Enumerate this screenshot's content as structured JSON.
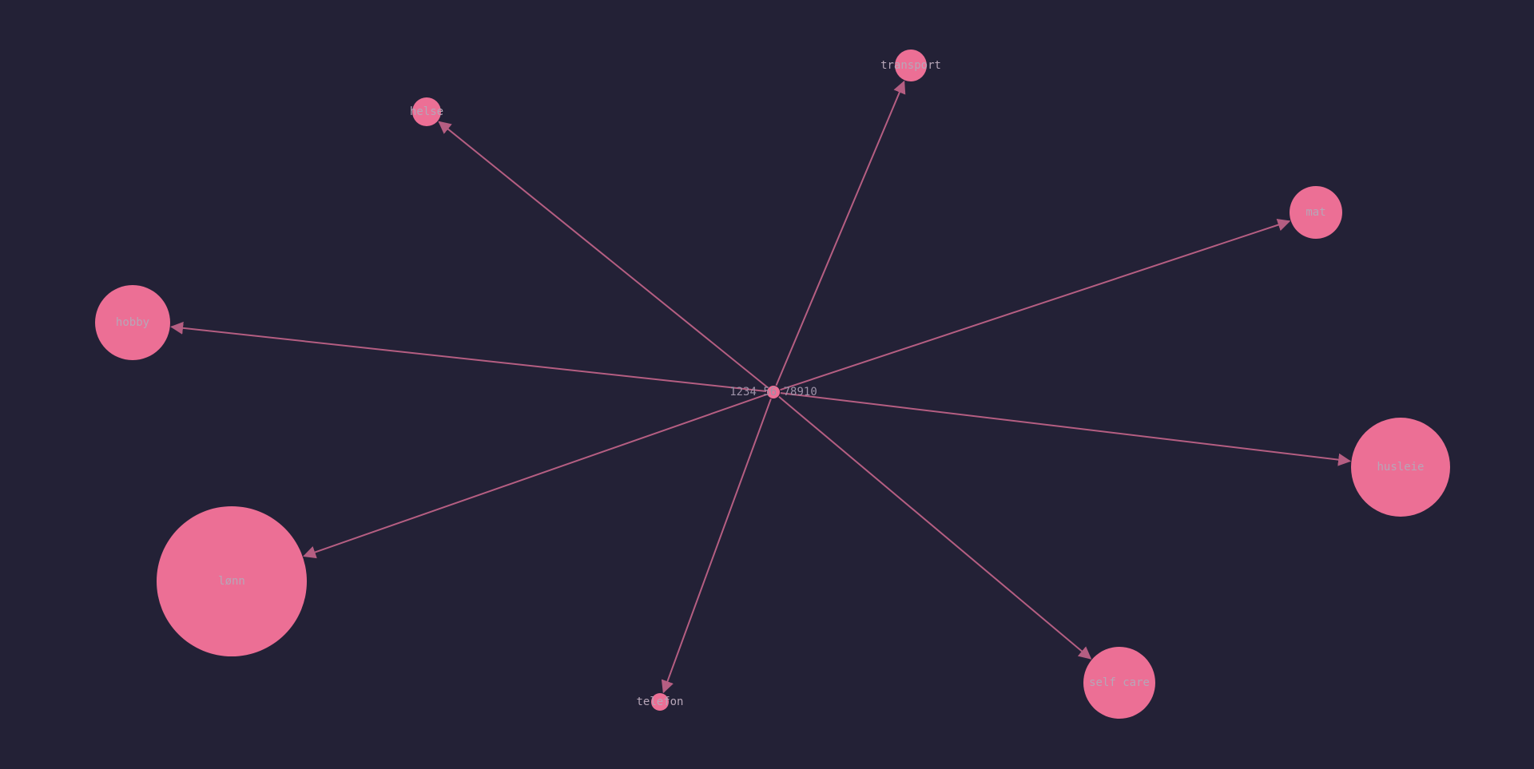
{
  "graph": {
    "center": {
      "label": "1234 56 78910",
      "color": "#ec6f95"
    },
    "nodes": [
      {
        "id": "transport",
        "label": "transport",
        "icon": "circle-node"
      },
      {
        "id": "helse",
        "label": "helse",
        "icon": "circle-node"
      },
      {
        "id": "mat",
        "label": "mat",
        "icon": "circle-node"
      },
      {
        "id": "hobby",
        "label": "hobby",
        "icon": "circle-node"
      },
      {
        "id": "husleie",
        "label": "husleie",
        "icon": "circle-node"
      },
      {
        "id": "lonn",
        "label": "lønn",
        "icon": "circle-node"
      },
      {
        "id": "telefon",
        "label": "telefon",
        "icon": "circle-node"
      },
      {
        "id": "self-care",
        "label": "self care",
        "icon": "circle-node"
      }
    ],
    "edges": [
      {
        "from": "center",
        "to": "transport"
      },
      {
        "from": "center",
        "to": "helse"
      },
      {
        "from": "center",
        "to": "mat"
      },
      {
        "from": "center",
        "to": "hobby"
      },
      {
        "from": "center",
        "to": "husleie"
      },
      {
        "from": "center",
        "to": "lonn"
      },
      {
        "from": "center",
        "to": "telefon"
      },
      {
        "from": "center",
        "to": "self-care"
      }
    ],
    "colors": {
      "background": "#232136",
      "node": "#ec6f95",
      "edge": "#b55e82",
      "label": "#b7a6b8"
    }
  }
}
